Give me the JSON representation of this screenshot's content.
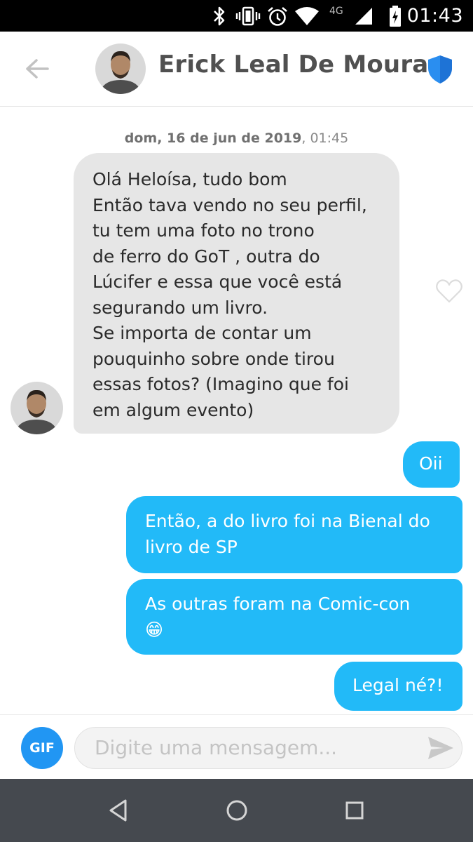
{
  "status_bar": {
    "time": "01:43",
    "network": "4G",
    "icons": [
      "bluetooth-icon",
      "vibrate-icon",
      "alarm-icon",
      "wifi-icon",
      "cell-signal-icon",
      "battery-icon"
    ]
  },
  "header": {
    "name": "Erick Leal De Moura",
    "back_icon": "arrow-left-icon",
    "verified_icon": "shield-icon",
    "accent_color": "#2a8ef0"
  },
  "chat": {
    "timestamp": {
      "date": "dom, 16 de jun de 2019",
      "time": ", 01:45"
    },
    "incoming": {
      "lines": [
        "Olá Heloísa, tudo bom",
        "Então tava vendo no seu perfil,",
        "tu tem uma foto no trono",
        "de ferro do GoT , outra do",
        "Lúcifer e essa que você está",
        "segurando um livro.",
        "Se importa de contar um",
        "pouquinho sobre onde tirou",
        "essas fotos? (Imagino que foi",
        "em algum evento)"
      ],
      "bubble_color": "#e6e6e6"
    },
    "outgoing": [
      {
        "lines": [
          "Oii"
        ]
      },
      {
        "lines": [
          "Então, a do livro foi na Bienal do",
          "livro de SP"
        ]
      },
      {
        "lines": [
          "As outras foram na Comic-con"
        ],
        "emoji": "😁"
      },
      {
        "lines": [
          "Legal né?!"
        ]
      }
    ],
    "outgoing_color": "#22baf8"
  },
  "composer": {
    "gif_label": "GIF",
    "placeholder": "Digite uma mensagem...",
    "send_icon": "send-icon"
  },
  "nav_bar": {
    "buttons": [
      "back-triangle-icon",
      "home-circle-icon",
      "recents-square-icon"
    ]
  }
}
